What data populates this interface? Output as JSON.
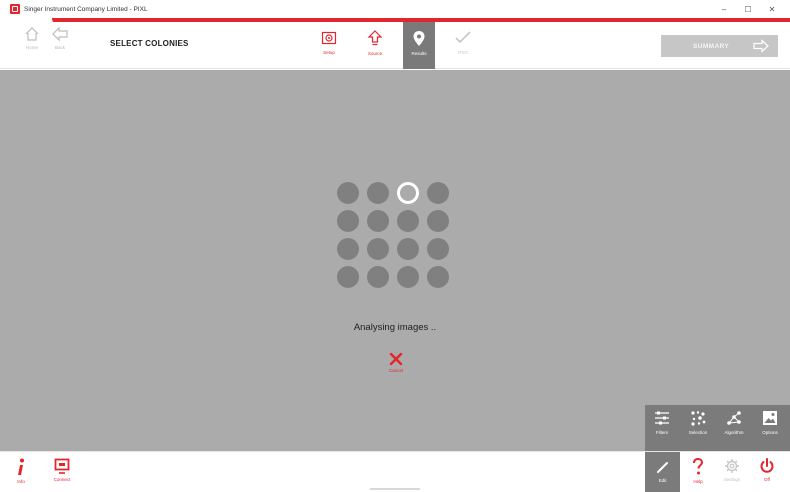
{
  "window": {
    "title": "Singer Instrument Company Limited - PIXL",
    "controls": [
      "–",
      "☐",
      "✕"
    ]
  },
  "toolbar": {
    "home_label": "Home",
    "back_label": "Back",
    "page_title": "SELECT COLONIES",
    "steps": [
      {
        "label": "Setup",
        "icon": "camera-settings-icon",
        "state": "done"
      },
      {
        "label": "Source",
        "icon": "upload-arrow-icon",
        "state": "done"
      },
      {
        "label": "Results",
        "icon": "location-pin-icon",
        "state": "active"
      },
      {
        "label": "PXG",
        "icon": "checkmark-icon",
        "state": "disabled"
      }
    ],
    "summary_label": "SUMMARY"
  },
  "main": {
    "status_text": "Analysing images ..",
    "cancel_label": "Cancel"
  },
  "tools": [
    {
      "label": "Filters",
      "icon": "sliders-icon"
    },
    {
      "label": "Selection",
      "icon": "selection-dots-icon"
    },
    {
      "label": "Algorithm",
      "icon": "network-icon"
    },
    {
      "label": "Options",
      "icon": "image-icon"
    }
  ],
  "bottombar": {
    "info_label": "Info",
    "connect_label": "Connect",
    "edit_label": "Edit",
    "help_label": "Help",
    "settings_label": "Settings",
    "off_label": "Off"
  },
  "colors": {
    "accent": "#e3262b",
    "canvas": "#ababab",
    "panel": "#7b7b7b",
    "dot": "#808080"
  }
}
